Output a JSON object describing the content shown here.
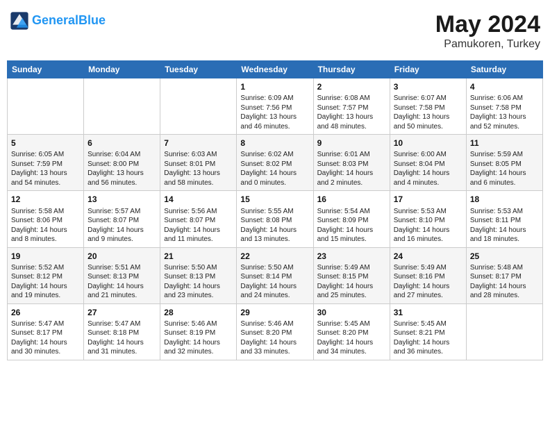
{
  "header": {
    "logo_general": "General",
    "logo_blue": "Blue",
    "month": "May 2024",
    "location": "Pamukoren, Turkey"
  },
  "weekdays": [
    "Sunday",
    "Monday",
    "Tuesday",
    "Wednesday",
    "Thursday",
    "Friday",
    "Saturday"
  ],
  "weeks": [
    [
      {
        "day": "",
        "sunrise": "",
        "sunset": "",
        "daylight": ""
      },
      {
        "day": "",
        "sunrise": "",
        "sunset": "",
        "daylight": ""
      },
      {
        "day": "",
        "sunrise": "",
        "sunset": "",
        "daylight": ""
      },
      {
        "day": "1",
        "sunrise": "Sunrise: 6:09 AM",
        "sunset": "Sunset: 7:56 PM",
        "daylight": "Daylight: 13 hours and 46 minutes."
      },
      {
        "day": "2",
        "sunrise": "Sunrise: 6:08 AM",
        "sunset": "Sunset: 7:57 PM",
        "daylight": "Daylight: 13 hours and 48 minutes."
      },
      {
        "day": "3",
        "sunrise": "Sunrise: 6:07 AM",
        "sunset": "Sunset: 7:58 PM",
        "daylight": "Daylight: 13 hours and 50 minutes."
      },
      {
        "day": "4",
        "sunrise": "Sunrise: 6:06 AM",
        "sunset": "Sunset: 7:58 PM",
        "daylight": "Daylight: 13 hours and 52 minutes."
      }
    ],
    [
      {
        "day": "5",
        "sunrise": "Sunrise: 6:05 AM",
        "sunset": "Sunset: 7:59 PM",
        "daylight": "Daylight: 13 hours and 54 minutes."
      },
      {
        "day": "6",
        "sunrise": "Sunrise: 6:04 AM",
        "sunset": "Sunset: 8:00 PM",
        "daylight": "Daylight: 13 hours and 56 minutes."
      },
      {
        "day": "7",
        "sunrise": "Sunrise: 6:03 AM",
        "sunset": "Sunset: 8:01 PM",
        "daylight": "Daylight: 13 hours and 58 minutes."
      },
      {
        "day": "8",
        "sunrise": "Sunrise: 6:02 AM",
        "sunset": "Sunset: 8:02 PM",
        "daylight": "Daylight: 14 hours and 0 minutes."
      },
      {
        "day": "9",
        "sunrise": "Sunrise: 6:01 AM",
        "sunset": "Sunset: 8:03 PM",
        "daylight": "Daylight: 14 hours and 2 minutes."
      },
      {
        "day": "10",
        "sunrise": "Sunrise: 6:00 AM",
        "sunset": "Sunset: 8:04 PM",
        "daylight": "Daylight: 14 hours and 4 minutes."
      },
      {
        "day": "11",
        "sunrise": "Sunrise: 5:59 AM",
        "sunset": "Sunset: 8:05 PM",
        "daylight": "Daylight: 14 hours and 6 minutes."
      }
    ],
    [
      {
        "day": "12",
        "sunrise": "Sunrise: 5:58 AM",
        "sunset": "Sunset: 8:06 PM",
        "daylight": "Daylight: 14 hours and 8 minutes."
      },
      {
        "day": "13",
        "sunrise": "Sunrise: 5:57 AM",
        "sunset": "Sunset: 8:07 PM",
        "daylight": "Daylight: 14 hours and 9 minutes."
      },
      {
        "day": "14",
        "sunrise": "Sunrise: 5:56 AM",
        "sunset": "Sunset: 8:07 PM",
        "daylight": "Daylight: 14 hours and 11 minutes."
      },
      {
        "day": "15",
        "sunrise": "Sunrise: 5:55 AM",
        "sunset": "Sunset: 8:08 PM",
        "daylight": "Daylight: 14 hours and 13 minutes."
      },
      {
        "day": "16",
        "sunrise": "Sunrise: 5:54 AM",
        "sunset": "Sunset: 8:09 PM",
        "daylight": "Daylight: 14 hours and 15 minutes."
      },
      {
        "day": "17",
        "sunrise": "Sunrise: 5:53 AM",
        "sunset": "Sunset: 8:10 PM",
        "daylight": "Daylight: 14 hours and 16 minutes."
      },
      {
        "day": "18",
        "sunrise": "Sunrise: 5:53 AM",
        "sunset": "Sunset: 8:11 PM",
        "daylight": "Daylight: 14 hours and 18 minutes."
      }
    ],
    [
      {
        "day": "19",
        "sunrise": "Sunrise: 5:52 AM",
        "sunset": "Sunset: 8:12 PM",
        "daylight": "Daylight: 14 hours and 19 minutes."
      },
      {
        "day": "20",
        "sunrise": "Sunrise: 5:51 AM",
        "sunset": "Sunset: 8:13 PM",
        "daylight": "Daylight: 14 hours and 21 minutes."
      },
      {
        "day": "21",
        "sunrise": "Sunrise: 5:50 AM",
        "sunset": "Sunset: 8:13 PM",
        "daylight": "Daylight: 14 hours and 23 minutes."
      },
      {
        "day": "22",
        "sunrise": "Sunrise: 5:50 AM",
        "sunset": "Sunset: 8:14 PM",
        "daylight": "Daylight: 14 hours and 24 minutes."
      },
      {
        "day": "23",
        "sunrise": "Sunrise: 5:49 AM",
        "sunset": "Sunset: 8:15 PM",
        "daylight": "Daylight: 14 hours and 25 minutes."
      },
      {
        "day": "24",
        "sunrise": "Sunrise: 5:49 AM",
        "sunset": "Sunset: 8:16 PM",
        "daylight": "Daylight: 14 hours and 27 minutes."
      },
      {
        "day": "25",
        "sunrise": "Sunrise: 5:48 AM",
        "sunset": "Sunset: 8:17 PM",
        "daylight": "Daylight: 14 hours and 28 minutes."
      }
    ],
    [
      {
        "day": "26",
        "sunrise": "Sunrise: 5:47 AM",
        "sunset": "Sunset: 8:17 PM",
        "daylight": "Daylight: 14 hours and 30 minutes."
      },
      {
        "day": "27",
        "sunrise": "Sunrise: 5:47 AM",
        "sunset": "Sunset: 8:18 PM",
        "daylight": "Daylight: 14 hours and 31 minutes."
      },
      {
        "day": "28",
        "sunrise": "Sunrise: 5:46 AM",
        "sunset": "Sunset: 8:19 PM",
        "daylight": "Daylight: 14 hours and 32 minutes."
      },
      {
        "day": "29",
        "sunrise": "Sunrise: 5:46 AM",
        "sunset": "Sunset: 8:20 PM",
        "daylight": "Daylight: 14 hours and 33 minutes."
      },
      {
        "day": "30",
        "sunrise": "Sunrise: 5:45 AM",
        "sunset": "Sunset: 8:20 PM",
        "daylight": "Daylight: 14 hours and 34 minutes."
      },
      {
        "day": "31",
        "sunrise": "Sunrise: 5:45 AM",
        "sunset": "Sunset: 8:21 PM",
        "daylight": "Daylight: 14 hours and 36 minutes."
      },
      {
        "day": "",
        "sunrise": "",
        "sunset": "",
        "daylight": ""
      }
    ]
  ]
}
